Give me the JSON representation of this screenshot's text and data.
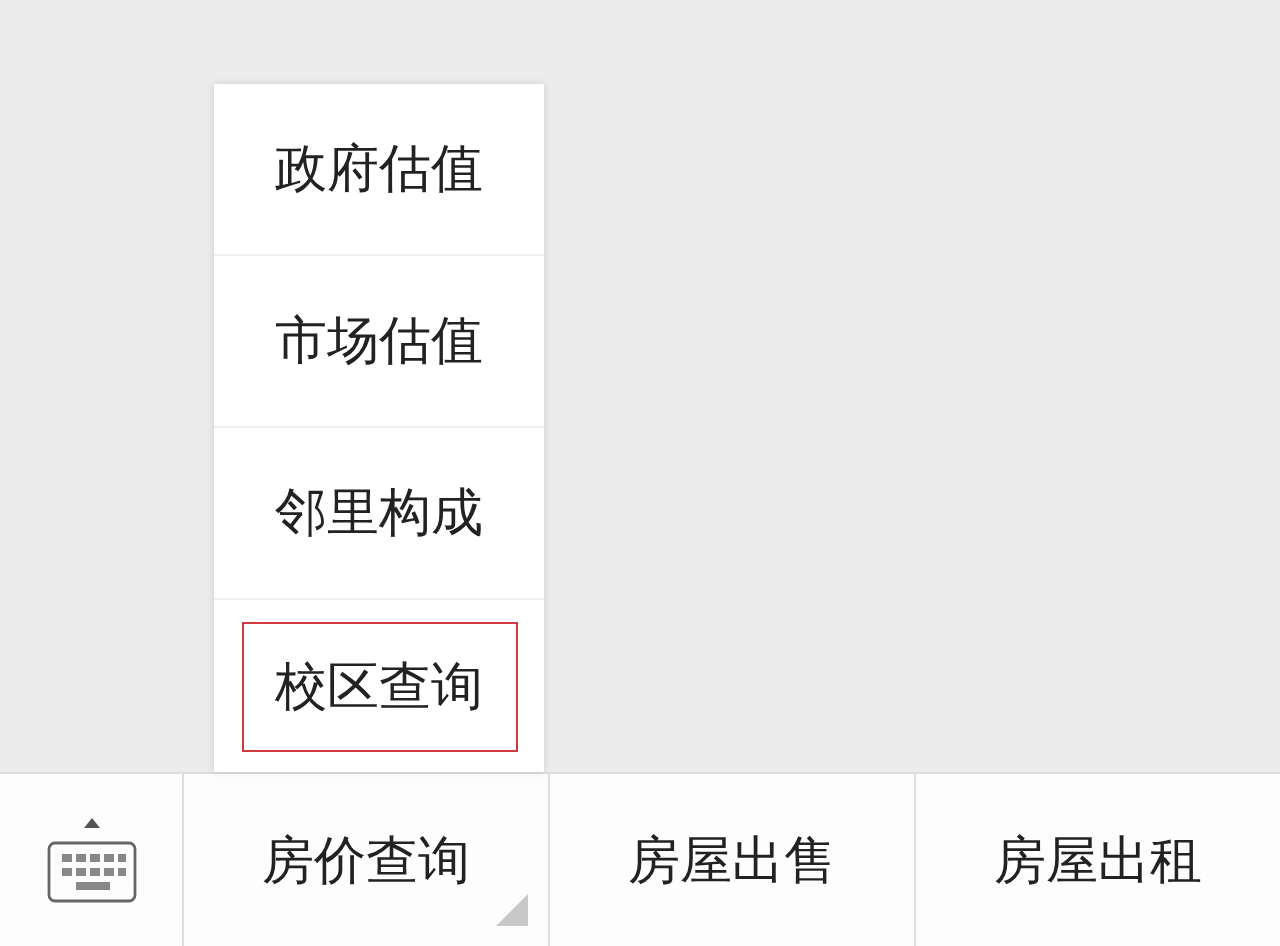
{
  "submenu": {
    "items": [
      {
        "label": "政府估值",
        "highlighted": false
      },
      {
        "label": "市场估值",
        "highlighted": false
      },
      {
        "label": "邻里构成",
        "highlighted": false
      },
      {
        "label": "校区查询",
        "highlighted": true
      }
    ]
  },
  "menu_bar": {
    "items": [
      {
        "label": "房价查询",
        "has_submenu": true
      },
      {
        "label": "房屋出售",
        "has_submenu": false
      },
      {
        "label": "房屋出租",
        "has_submenu": false
      }
    ]
  }
}
